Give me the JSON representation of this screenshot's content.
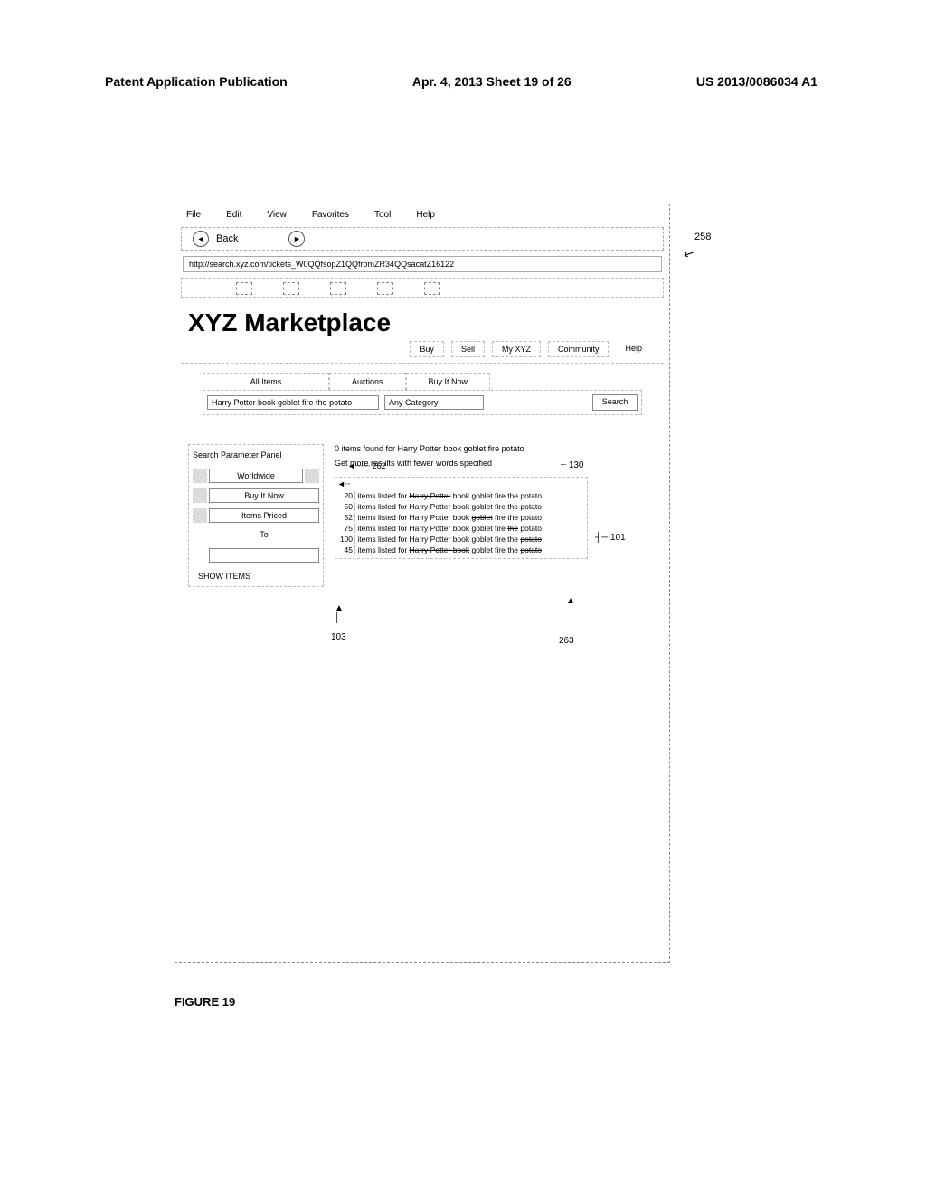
{
  "header": {
    "left": "Patent Application Publication",
    "center": "Apr. 4, 2013   Sheet 19 of 26",
    "right": "US 2013/0086034 A1"
  },
  "figure_label": "FIGURE 19",
  "callout_258": "258",
  "browser": {
    "menu": {
      "file": "File",
      "edit": "Edit",
      "view": "View",
      "favorites": "Favorites",
      "tool": "Tool",
      "help": "Help"
    },
    "back_label": "Back",
    "address": "http://search.xyz.com/tickets_W0QQfsopZ1QQfromZR34QQsacatZ16122"
  },
  "site": {
    "title": "XYZ Marketplace",
    "nav": {
      "buy": "Buy",
      "sell": "Sell",
      "myxyz": "My XYZ",
      "community": "Community",
      "help": "Help"
    },
    "subtabs": {
      "all": "All Items",
      "auctions": "Auctions",
      "buynow": "Buy It Now"
    },
    "search_value": "Harry Potter book goblet fire the potato",
    "category": "Any Category",
    "search_btn": "Search",
    "annot_262": "262"
  },
  "sidepanel": {
    "title": "Search Parameter Panel",
    "worldwide": "Worldwide",
    "buyitnow": "Buy It Now",
    "itemspriced": "Items Priced",
    "to": "To",
    "showitems": "SHOW ITEMS"
  },
  "results": {
    "zero": "0 items found for Harry Potter book goblet fire potato",
    "hint": "Get more results with fewer words specified",
    "annot_130": "130",
    "annot_101": "101",
    "annot_103": "103",
    "annot_263": "263",
    "lines": [
      {
        "count": "20",
        "pre": "items listed for ",
        "s1": "Harry Potter",
        "mid": " book goblet fire the potato"
      },
      {
        "count": "50",
        "pre": "items listed for Harry Potter ",
        "s1": "book",
        "mid": " goblet fire the potato"
      },
      {
        "count": "52",
        "pre": "items listed for Harry Potter book ",
        "s1": "goblet",
        "mid": " fire the potato"
      },
      {
        "count": "75",
        "pre": "items listed for Harry Potter book goblet fire ",
        "s1": "the",
        "mid": " potato"
      },
      {
        "count": "100",
        "pre": "items listed for Harry Potter book goblet fire the ",
        "s1": "potato",
        "mid": ""
      },
      {
        "count": "45",
        "pre": "items listed for ",
        "s1": "Harry Potter book",
        "mid": " goblet fire the ",
        "s2": "potato"
      }
    ]
  }
}
